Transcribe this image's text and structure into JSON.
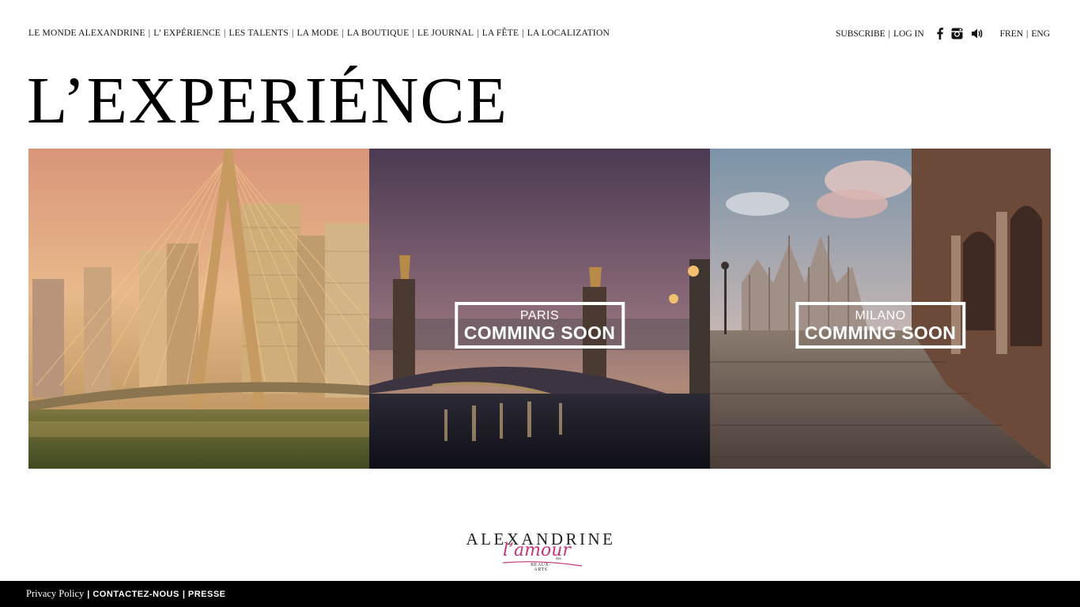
{
  "nav": {
    "items": [
      {
        "label": "LE MONDE ALEXANDRINE"
      },
      {
        "label": "L’ EXPÉRIENCE"
      },
      {
        "label": "LES TALENTS"
      },
      {
        "label": "LA MODE"
      },
      {
        "label": "LA BOUTIQUE"
      },
      {
        "label": "LE JOURNAL"
      },
      {
        "label": "LA FÊTE"
      },
      {
        "label": "LA LOCALIZATION"
      }
    ],
    "separator": "|"
  },
  "account": {
    "subscribe": "SUBSCRIBE",
    "login": "LOG IN",
    "icons": [
      "facebook-icon",
      "instagram-icon",
      "sound-icon"
    ]
  },
  "language": {
    "fr": "FREN",
    "en": "ENG"
  },
  "page": {
    "title": "L’EXPERIÉNCE"
  },
  "panels": [
    {
      "city": "",
      "status": ""
    },
    {
      "city": "PARIS",
      "status": "COMMING SOON"
    },
    {
      "city": "MILANO",
      "status": "COMMING SOON"
    }
  ],
  "logo": {
    "brand": "ALEXANDRINE",
    "script": "l’amour",
    "des": "des",
    "beaux": "BEAUX-ARTS"
  },
  "footer": {
    "privacy": "Privacy Policy",
    "contact": "CONTACTEZ-NOUS",
    "presse": "PRESSE",
    "separator": "|"
  },
  "colors": {
    "accent_pink": "#c8327a",
    "footer_bg": "#000000"
  }
}
